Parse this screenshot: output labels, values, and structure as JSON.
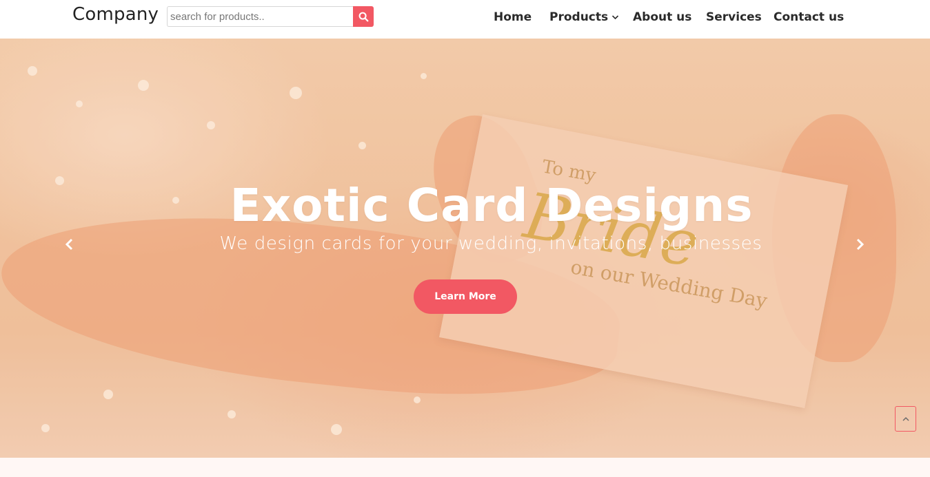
{
  "header": {
    "brand": "Company",
    "search": {
      "placeholder": "search for products..",
      "value": "",
      "button_icon": "search-icon"
    },
    "nav": [
      {
        "label": "Home"
      },
      {
        "label": "Products",
        "icon": "chevron-down-icon"
      },
      {
        "label": "About us"
      },
      {
        "label": "Services"
      },
      {
        "label": "Contact us"
      }
    ]
  },
  "hero": {
    "title": "Exotic Card Designs",
    "subtitle": "We design cards for your wedding, invitations, businesses",
    "cta_label": "Learn More",
    "prev_icon": "chevron-left-icon",
    "next_icon": "chevron-right-icon",
    "card": {
      "line1": "To my",
      "script": "Bride",
      "line2": "on our Wedding Day"
    }
  },
  "scroll_top_icon": "chevron-up-icon",
  "colors": {
    "accent": "#f25863",
    "text_dark": "#2a2a2a",
    "hero_tint": "#f1c8a6"
  }
}
